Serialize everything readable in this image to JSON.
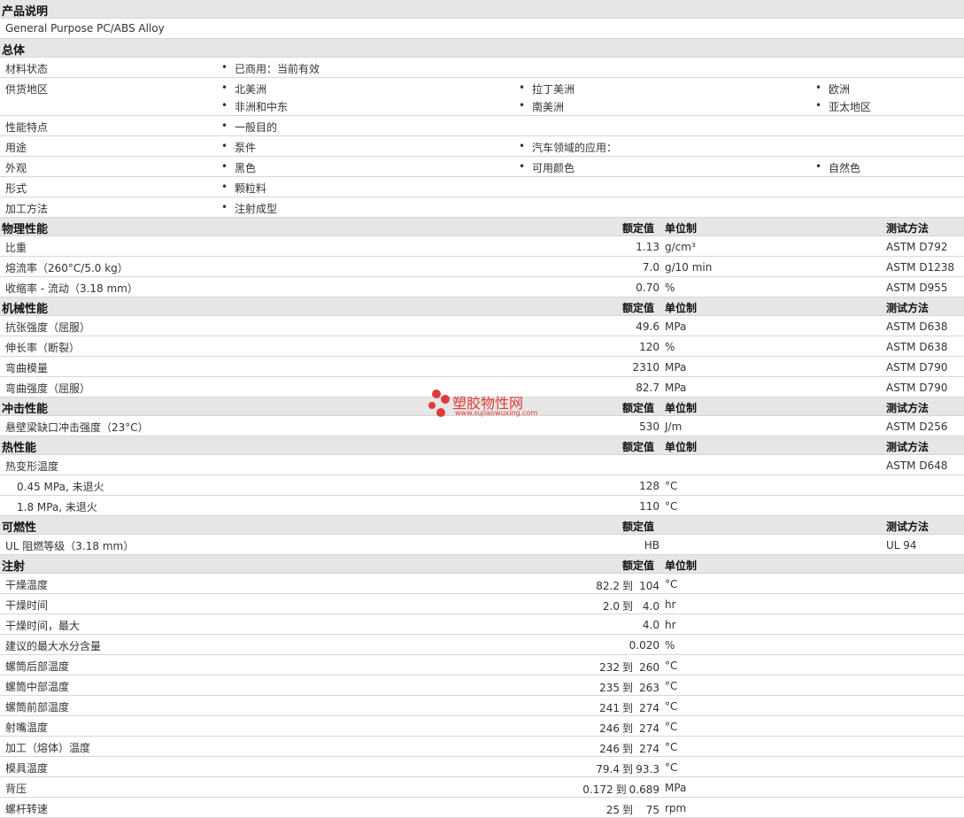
{
  "product": {
    "title": "产品说明",
    "description": "General Purpose PC/ABS Alloy"
  },
  "general": {
    "title": "总体",
    "rows": [
      {
        "label": "材料状态",
        "items": [
          "已商用：当前有效"
        ]
      },
      {
        "label": "供货地区",
        "items": [
          "北美洲",
          "拉丁美洲",
          "欧洲",
          "非洲和中东",
          "南美洲",
          "亚太地区"
        ]
      },
      {
        "label": "性能特点",
        "items": [
          "一般目的"
        ]
      },
      {
        "label": "用途",
        "items": [
          "泵件",
          "汽车领域的应用："
        ]
      },
      {
        "label": "外观",
        "items": [
          "黑色",
          "可用颜色",
          "自然色"
        ]
      },
      {
        "label": "形式",
        "items": [
          "颗粒料"
        ]
      },
      {
        "label": "加工方法",
        "items": [
          "注射成型"
        ]
      }
    ]
  },
  "headers": {
    "nominal": "额定值",
    "unit": "单位制",
    "test": "测试方法"
  },
  "physical": {
    "title": "物理性能",
    "rows": [
      {
        "label": "比重",
        "value": "1.13",
        "unit": "g/cm³",
        "test": "ASTM D792"
      },
      {
        "label": "熔流率（260°C/5.0 kg）",
        "value": "7.0",
        "unit": "g/10 min",
        "test": "ASTM D1238"
      },
      {
        "label": "收缩率 - 流动（3.18 mm）",
        "value": "0.70",
        "unit": "%",
        "test": "ASTM D955"
      }
    ]
  },
  "mechanical": {
    "title": "机械性能",
    "rows": [
      {
        "label": "抗张强度（屈服）",
        "value": "49.6",
        "unit": "MPa",
        "test": "ASTM D638"
      },
      {
        "label": "伸长率（断裂）",
        "value": "120",
        "unit": "%",
        "test": "ASTM D638"
      },
      {
        "label": "弯曲模量",
        "value": "2310",
        "unit": "MPa",
        "test": "ASTM D790"
      },
      {
        "label": "弯曲强度（屈服）",
        "value": "82.7",
        "unit": "MPa",
        "test": "ASTM D790"
      }
    ]
  },
  "impact": {
    "title": "冲击性能",
    "rows": [
      {
        "label": "悬壁梁缺口冲击强度（23°C）",
        "value": "530",
        "unit": "J/m",
        "test": "ASTM D256"
      }
    ]
  },
  "thermal": {
    "title": "热性能",
    "rows": [
      {
        "label": "热变形温度",
        "value": "",
        "unit": "",
        "test": "ASTM D648"
      },
      {
        "label": "0.45 MPa, 未退火",
        "value": "128",
        "unit": "°C",
        "test": ""
      },
      {
        "label": "1.8 MPa, 未退火",
        "value": "110",
        "unit": "°C",
        "test": ""
      }
    ]
  },
  "flammability": {
    "title": "可燃性",
    "rows": [
      {
        "label": "UL 阻燃等级（3.18 mm）",
        "value": "HB",
        "unit": "",
        "test": "UL 94"
      }
    ]
  },
  "injection": {
    "title": "注射",
    "to": "到",
    "rows": [
      {
        "label": "干燥温度",
        "a": "82.2",
        "b": "104",
        "unit": "°C"
      },
      {
        "label": "干燥时间",
        "a": "2.0",
        "b": "4.0",
        "unit": "hr"
      },
      {
        "label": "干燥时间，最大",
        "a": "",
        "b": "4.0",
        "unit": "hr"
      },
      {
        "label": "建议的最大水分含量",
        "a": "",
        "b": "0.020",
        "unit": "%"
      },
      {
        "label": "螺筒后部温度",
        "a": "232",
        "b": "260",
        "unit": "°C"
      },
      {
        "label": "螺筒中部温度",
        "a": "235",
        "b": "263",
        "unit": "°C"
      },
      {
        "label": "螺筒前部温度",
        "a": "241",
        "b": "274",
        "unit": "°C"
      },
      {
        "label": "射嘴温度",
        "a": "246",
        "b": "274",
        "unit": "°C"
      },
      {
        "label": "加工（熔体）温度",
        "a": "246",
        "b": "274",
        "unit": "°C"
      },
      {
        "label": "模具温度",
        "a": "79.4",
        "b": "93.3",
        "unit": "°C"
      },
      {
        "label": "背压",
        "a": "0.172",
        "b": "0.689",
        "unit": "MPa"
      },
      {
        "label": "螺杆转速",
        "a": "25",
        "b": "75",
        "unit": "rpm"
      }
    ]
  },
  "watermark": {
    "text": "塑胶物性网",
    "url": "www.sujiaowuxing.com",
    "color": "#e03a3a"
  }
}
